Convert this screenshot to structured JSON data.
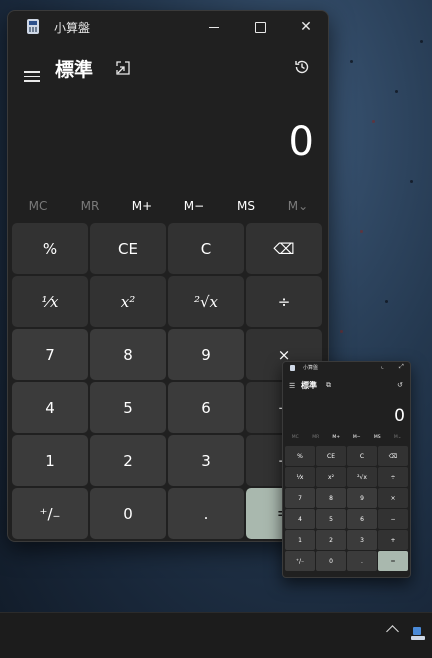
{
  "window": {
    "title": "小算盤",
    "mode": "標準",
    "display": "0"
  },
  "memory": [
    {
      "label": "MC",
      "enabled": false
    },
    {
      "label": "MR",
      "enabled": false
    },
    {
      "label": "M+",
      "enabled": true
    },
    {
      "label": "M−",
      "enabled": true
    },
    {
      "label": "MS",
      "enabled": true
    },
    {
      "label": "M⌄",
      "enabled": false
    }
  ],
  "keys": [
    {
      "label": "%",
      "name": "percent-button",
      "kind": "fn"
    },
    {
      "label": "CE",
      "name": "clear-entry-button",
      "kind": "fn"
    },
    {
      "label": "C",
      "name": "clear-button",
      "kind": "fn"
    },
    {
      "label": "⌫",
      "name": "backspace-button",
      "kind": "fn"
    },
    {
      "label": "¹⁄x",
      "name": "reciprocal-button",
      "kind": "fn"
    },
    {
      "label": "x²",
      "name": "square-button",
      "kind": "fn"
    },
    {
      "label": "²√x",
      "name": "square-root-button",
      "kind": "fn"
    },
    {
      "label": "÷",
      "name": "divide-button",
      "kind": "fn"
    },
    {
      "label": "7",
      "name": "digit-7-button",
      "kind": "num"
    },
    {
      "label": "8",
      "name": "digit-8-button",
      "kind": "num"
    },
    {
      "label": "9",
      "name": "digit-9-button",
      "kind": "num"
    },
    {
      "label": "×",
      "name": "multiply-button",
      "kind": "fn"
    },
    {
      "label": "4",
      "name": "digit-4-button",
      "kind": "num"
    },
    {
      "label": "5",
      "name": "digit-5-button",
      "kind": "num"
    },
    {
      "label": "6",
      "name": "digit-6-button",
      "kind": "num"
    },
    {
      "label": "−",
      "name": "minus-button",
      "kind": "fn"
    },
    {
      "label": "1",
      "name": "digit-1-button",
      "kind": "num"
    },
    {
      "label": "2",
      "name": "digit-2-button",
      "kind": "num"
    },
    {
      "label": "3",
      "name": "digit-3-button",
      "kind": "num"
    },
    {
      "label": "+",
      "name": "plus-button",
      "kind": "fn"
    },
    {
      "label": "⁺/₋",
      "name": "negate-button",
      "kind": "num"
    },
    {
      "label": "0",
      "name": "digit-0-button",
      "kind": "num"
    },
    {
      "label": ".",
      "name": "decimal-button",
      "kind": "num"
    },
    {
      "label": "=",
      "name": "equals-button",
      "kind": "eq"
    }
  ],
  "mini": {
    "title": "小算盤",
    "mode": "標準",
    "display": "0",
    "memory": [
      "MC",
      "MR",
      "M+",
      "M−",
      "MS",
      "M⌄"
    ],
    "keys": [
      "%",
      "CE",
      "C",
      "⌫",
      "¹⁄x",
      "x²",
      "²√x",
      "÷",
      "7",
      "8",
      "9",
      "×",
      "4",
      "5",
      "6",
      "−",
      "1",
      "2",
      "3",
      "+",
      "⁺/₋",
      "0",
      ".",
      "="
    ]
  }
}
